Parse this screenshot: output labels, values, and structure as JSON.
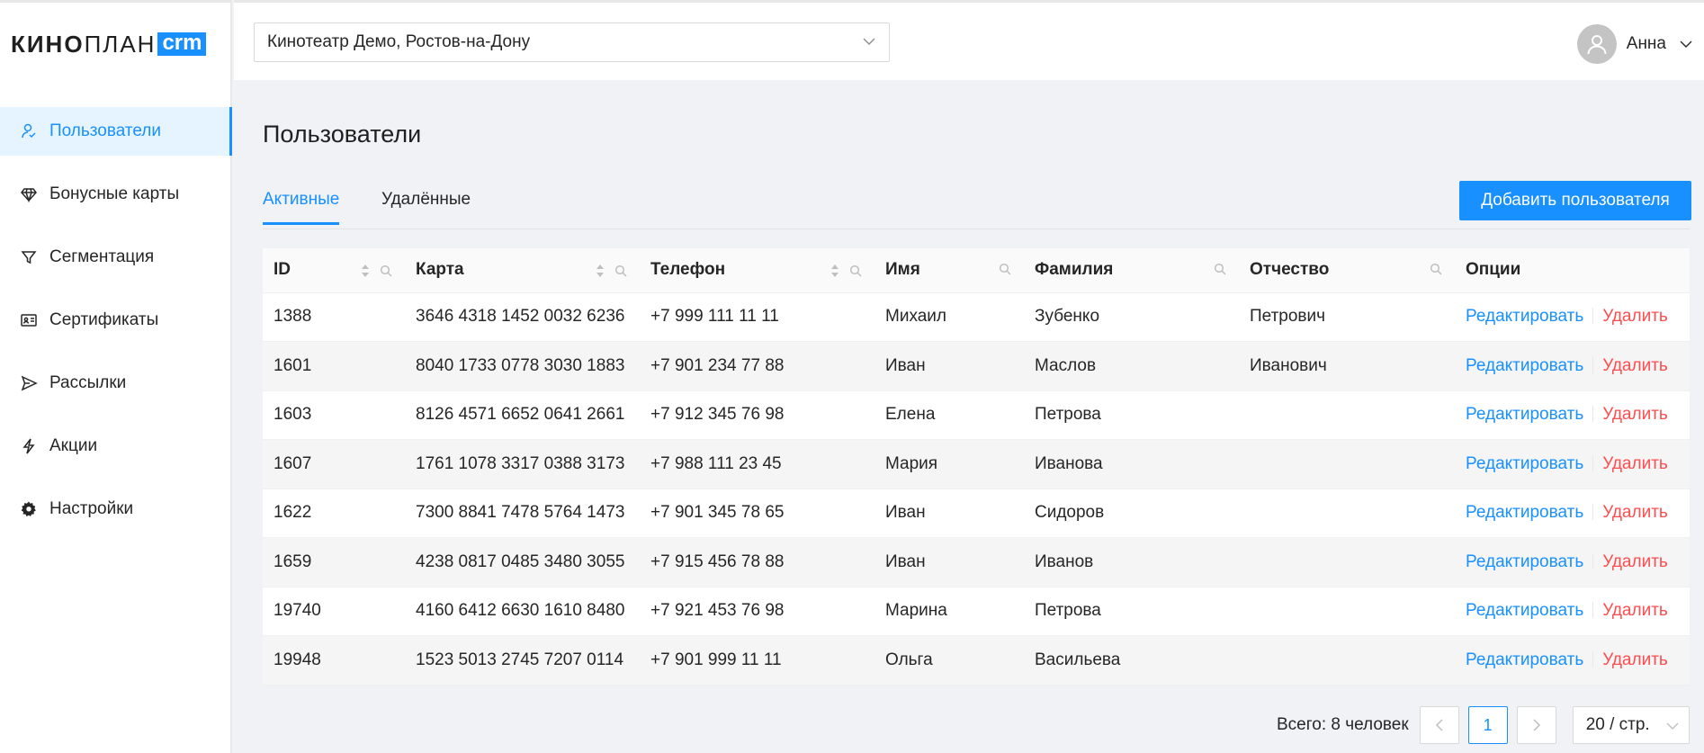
{
  "app": {
    "logo_part1": "КИНО",
    "logo_part2": "ПЛАН",
    "logo_badge": "crm"
  },
  "sidebar": {
    "items": [
      {
        "label": "Пользователи",
        "icon": "users-icon",
        "active": true
      },
      {
        "label": "Бонусные карты",
        "icon": "diamond-icon",
        "active": false
      },
      {
        "label": "Сегментация",
        "icon": "filter-icon",
        "active": false
      },
      {
        "label": "Сертификаты",
        "icon": "id-card-icon",
        "active": false
      },
      {
        "label": "Рассылки",
        "icon": "send-icon",
        "active": false
      },
      {
        "label": "Акции",
        "icon": "lightning-icon",
        "active": false
      },
      {
        "label": "Настройки",
        "icon": "gear-icon",
        "active": false
      }
    ]
  },
  "header": {
    "cinema": "Кинотеатр Демо, Ростов-на-Дону",
    "user_name": "Анна"
  },
  "main": {
    "title": "Пользователи",
    "tabs": [
      {
        "label": "Активные",
        "active": true
      },
      {
        "label": "Удалённые",
        "active": false
      }
    ],
    "add_button": "Добавить пользователя"
  },
  "table": {
    "columns": [
      "ID",
      "Карта",
      "Телефон",
      "Имя",
      "Фамилия",
      "Отчество",
      "Опции"
    ],
    "rows": [
      {
        "id": "1388",
        "card": "3646 4318 1452 0032 6236",
        "phone": "+7 999 111 11 11",
        "first": "Михаил",
        "last": "Зубенко",
        "middle": "Петрович"
      },
      {
        "id": "1601",
        "card": "8040 1733 0778 3030 1883",
        "phone": "+7 901 234 77 88",
        "first": "Иван",
        "last": "Маслов",
        "middle": "Иванович"
      },
      {
        "id": "1603",
        "card": "8126 4571 6652 0641 2661",
        "phone": "+7 912 345 76 98",
        "first": "Елена",
        "last": "Петрова",
        "middle": ""
      },
      {
        "id": "1607",
        "card": "1761 1078 3317 0388 3173",
        "phone": "+7 988 111 23 45",
        "first": "Мария",
        "last": "Иванова",
        "middle": ""
      },
      {
        "id": "1622",
        "card": "7300 8841 7478 5764 1473",
        "phone": "+7 901 345 78 65",
        "first": "Иван",
        "last": "Сидоров",
        "middle": ""
      },
      {
        "id": "1659",
        "card": "4238 0817 0485 3480 3055",
        "phone": "+7 915 456 78 88",
        "first": "Иван",
        "last": "Иванов",
        "middle": ""
      },
      {
        "id": "19740",
        "card": "4160 6412 6630 1610 8480",
        "phone": "+7 921 453 76 98",
        "first": "Марина",
        "last": "Петрова",
        "middle": ""
      },
      {
        "id": "19948",
        "card": "1523 5013 2745 7207 0114",
        "phone": "+7 901 999 11 11",
        "first": "Ольга",
        "last": "Васильева",
        "middle": ""
      }
    ],
    "edit_label": "Редактировать",
    "delete_label": "Удалить"
  },
  "pagination": {
    "total": "Всего: 8 человек",
    "current_page": "1",
    "page_size": "20 / стр."
  },
  "colors": {
    "accent": "#1890ff",
    "danger": "#ff4d4f"
  }
}
